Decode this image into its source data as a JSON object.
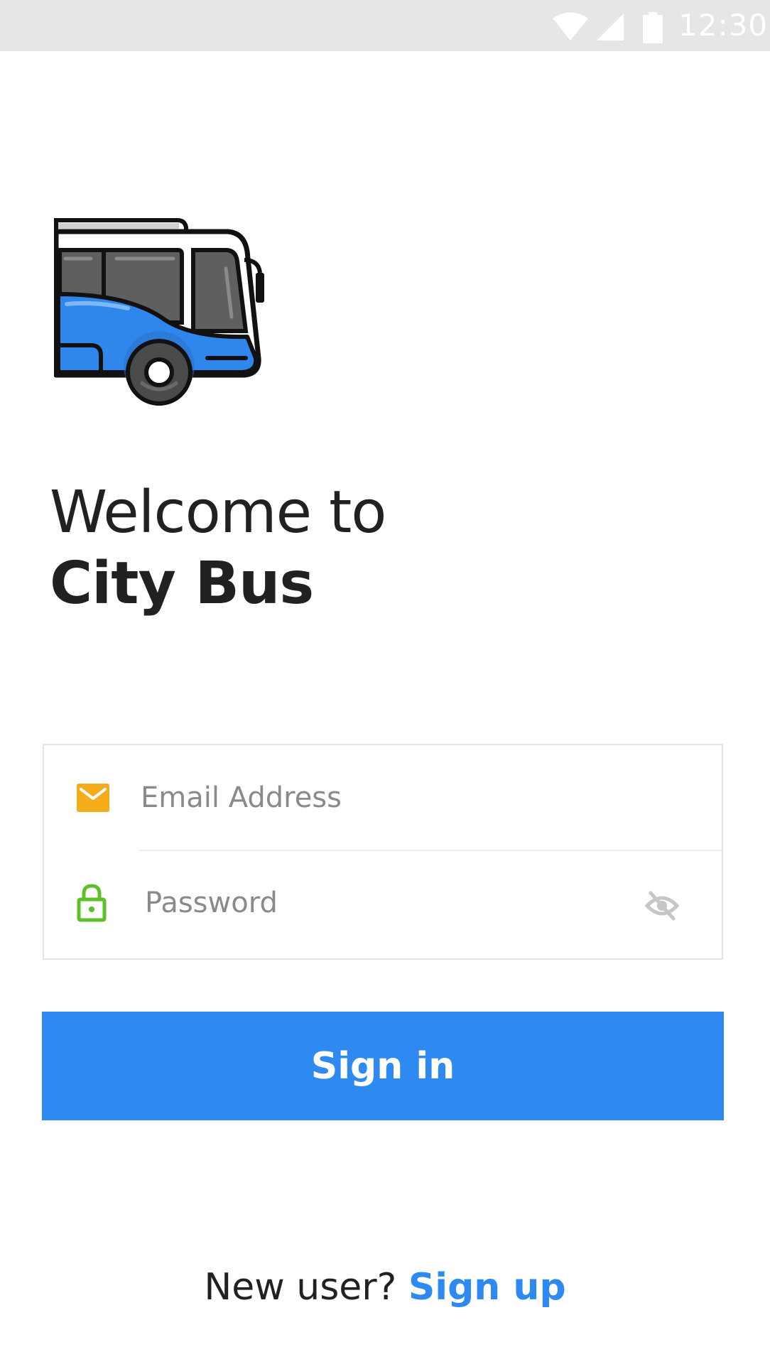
{
  "status_bar": {
    "time": "12:30",
    "icons": [
      "wifi-icon",
      "signal-icon",
      "battery-icon"
    ]
  },
  "logo": {
    "icon": "bus-icon",
    "colors": {
      "body": "#2f86ec",
      "window": "#5f5f5f",
      "outline": "#111111",
      "wheel": "#4a4a4a"
    }
  },
  "headline": {
    "line1": "Welcome to",
    "line2": "City Bus"
  },
  "form": {
    "email": {
      "placeholder": "Email Address",
      "value": "",
      "icon": "mail-icon",
      "icon_color": "#f5ac1b"
    },
    "password": {
      "placeholder": "Password",
      "value": "",
      "icon": "lock-icon",
      "icon_color": "#5cc126",
      "toggle_icon": "eye-off-icon"
    }
  },
  "sign_in": {
    "label": "Sign in",
    "color": "#2e8af0"
  },
  "footer": {
    "prompt": "New user?",
    "link_label": "Sign up",
    "link_color": "#2e8af0"
  }
}
